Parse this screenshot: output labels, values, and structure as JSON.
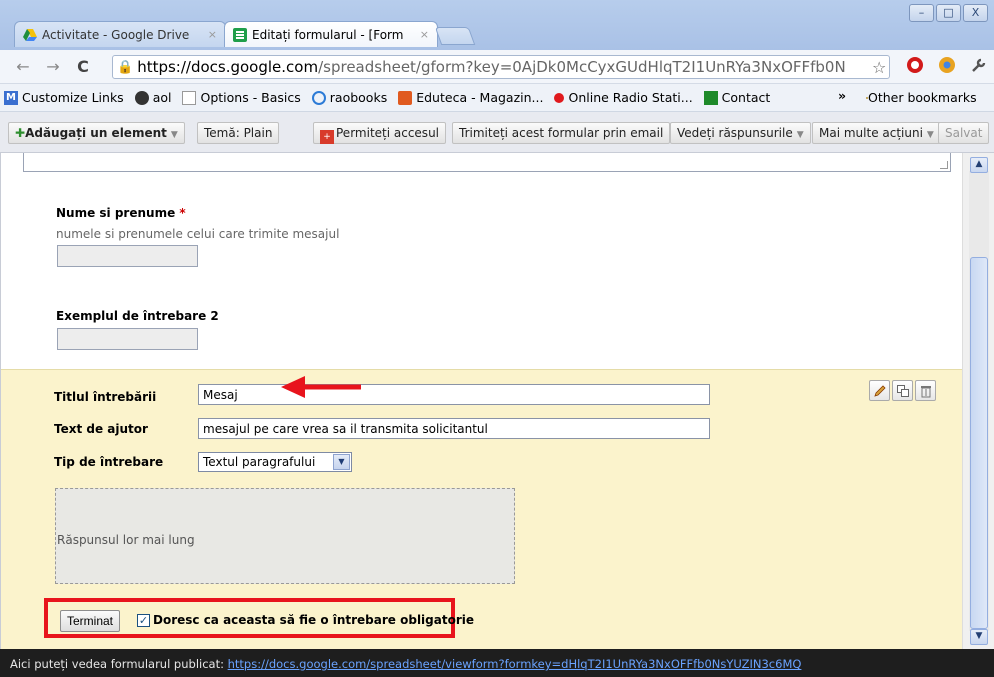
{
  "browser": {
    "tabs": [
      {
        "title": "Activitate - Google Drive",
        "close": "×"
      },
      {
        "title": "Editați formularul - [Form",
        "close": "×"
      }
    ],
    "window_buttons": [
      "–",
      "□",
      "X"
    ],
    "nav": {
      "back": "←",
      "forward": "→",
      "reload": "C"
    },
    "url": {
      "prefix": "https://docs.google.com",
      "rest": "/spreadsheet/gform?key=0AjDk0McCyxGUdHlqT2I1UnRYa3NxOFFfb0N"
    },
    "bookmarks": [
      {
        "label": "Customize Links",
        "color": "#3a6fd0"
      },
      {
        "label": "aol",
        "color": "#333333"
      },
      {
        "label": "Options - Basics",
        "color": "#ffffff"
      },
      {
        "label": "raobooks",
        "color": "#2c7bd6"
      },
      {
        "label": "Eduteca - Magazin...",
        "color": "#e05a1f"
      },
      {
        "label": "Online Radio Stati...",
        "color": "#e0191d"
      },
      {
        "label": "Contact",
        "color": "#1e8a2a"
      }
    ],
    "bookmarks_more": "»",
    "other_bookmarks": "Other bookmarks"
  },
  "toolbar": {
    "add_item": "Adăugați un element",
    "theme": "Temă: Plain",
    "share": "Permiteți accesul",
    "email_form": "Trimiteți acest formular prin email",
    "view_responses": "Vedeți răspunsurile",
    "more_actions": "Mai multe acțiuni",
    "saved": "Salvat"
  },
  "form": {
    "q1": {
      "title": "Nume si prenume",
      "required_mark": "*",
      "help": "numele si prenumele celui care trimite mesajul"
    },
    "q2": {
      "title": "Exemplul de întrebare 2"
    },
    "edit": {
      "title_label": "Titlul întrebării",
      "title_value": "Mesaj",
      "help_label": "Text de ajutor",
      "help_value": "mesajul pe care vrea sa il transmita solicitantul",
      "type_label": "Tip de întrebare",
      "type_value": "Textul paragrafului",
      "preview_text": "Răspunsul lor mai lung",
      "done_button": "Terminat",
      "required_label": "Doresc ca aceasta să fie o întrebare obligatorie",
      "required_checked": true
    }
  },
  "status": {
    "text": "Aici puteți vedea formularul publicat: ",
    "link": "https://docs.google.com/spreadsheet/viewform?formkey=dHlqT2I1UnRYa3NxOFFfb0NsYUZIN3c6MQ"
  },
  "colors": {
    "highlight": "#e8141c",
    "panel": "#fbf3cc"
  }
}
